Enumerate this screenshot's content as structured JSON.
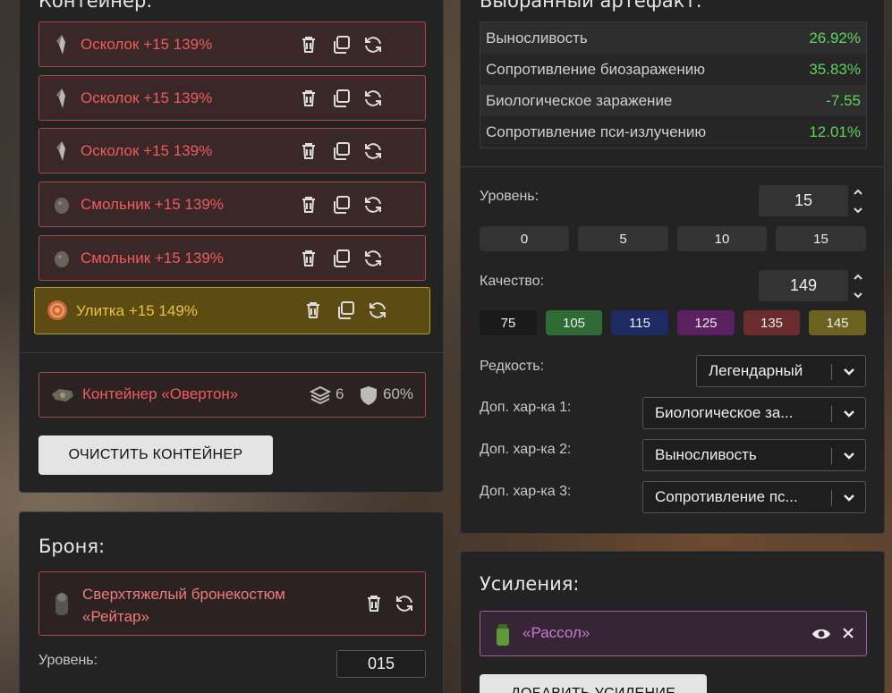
{
  "container_panel": {
    "title": "Контейнер:",
    "artifacts": [
      {
        "label": "Осколок +15 139%"
      },
      {
        "label": "Осколок +15 139%"
      },
      {
        "label": "Осколок +15 139%"
      },
      {
        "label": "Смольник +15 139%"
      },
      {
        "label": "Смольник +15 139%"
      },
      {
        "label": "Улитка +15 149%"
      }
    ],
    "container": {
      "name": "Контейнер «Овертон»",
      "slots": "6",
      "protection": "60%"
    },
    "clear_button": "ОЧИСТИТЬ КОНТЕЙНЕР"
  },
  "armor_panel": {
    "title": "Броня:",
    "armor_name": "Сверхтяжелый бронекостюм «Рейтар»",
    "level_label": "Уровень:",
    "level_value": "015"
  },
  "selected_panel": {
    "title": "Выбранный артефакт:",
    "stats": [
      {
        "name": "Выносливость",
        "value": "26.92%"
      },
      {
        "name": "Сопротивление биозаражению",
        "value": "35.83%"
      },
      {
        "name": "Биологическое заражение",
        "value": "-7.55"
      },
      {
        "name": "Сопротивление пси-излучению",
        "value": "12.01%"
      }
    ],
    "level_label": "Уровень:",
    "level_value": "15",
    "level_presets": [
      "0",
      "5",
      "10",
      "15"
    ],
    "quality_label": "Качество:",
    "quality_value": "149",
    "quality_presets": [
      {
        "label": "75",
        "color": "#1a1a1a"
      },
      {
        "label": "105",
        "color": "#2e6b35"
      },
      {
        "label": "115",
        "color": "#1e2a62"
      },
      {
        "label": "125",
        "color": "#5a2060"
      },
      {
        "label": "135",
        "color": "#6a2c2c"
      },
      {
        "label": "145",
        "color": "#6b6220"
      }
    ],
    "rarity_label": "Редкость:",
    "rarity_value": "Легендарный",
    "extra1_label": "Доп. хар-ка 1:",
    "extra1_value": "Биологическое за...",
    "extra2_label": "Доп. хар-ка 2:",
    "extra2_value": "Выносливость",
    "extra3_label": "Доп. хар-ка 3:",
    "extra3_value": "Сопротивление пс..."
  },
  "boost_panel": {
    "title": "Усиления:",
    "boost_name": "«Рассол»",
    "add_button": "ДОБАВИТЬ УСИЛЕНИЕ"
  }
}
